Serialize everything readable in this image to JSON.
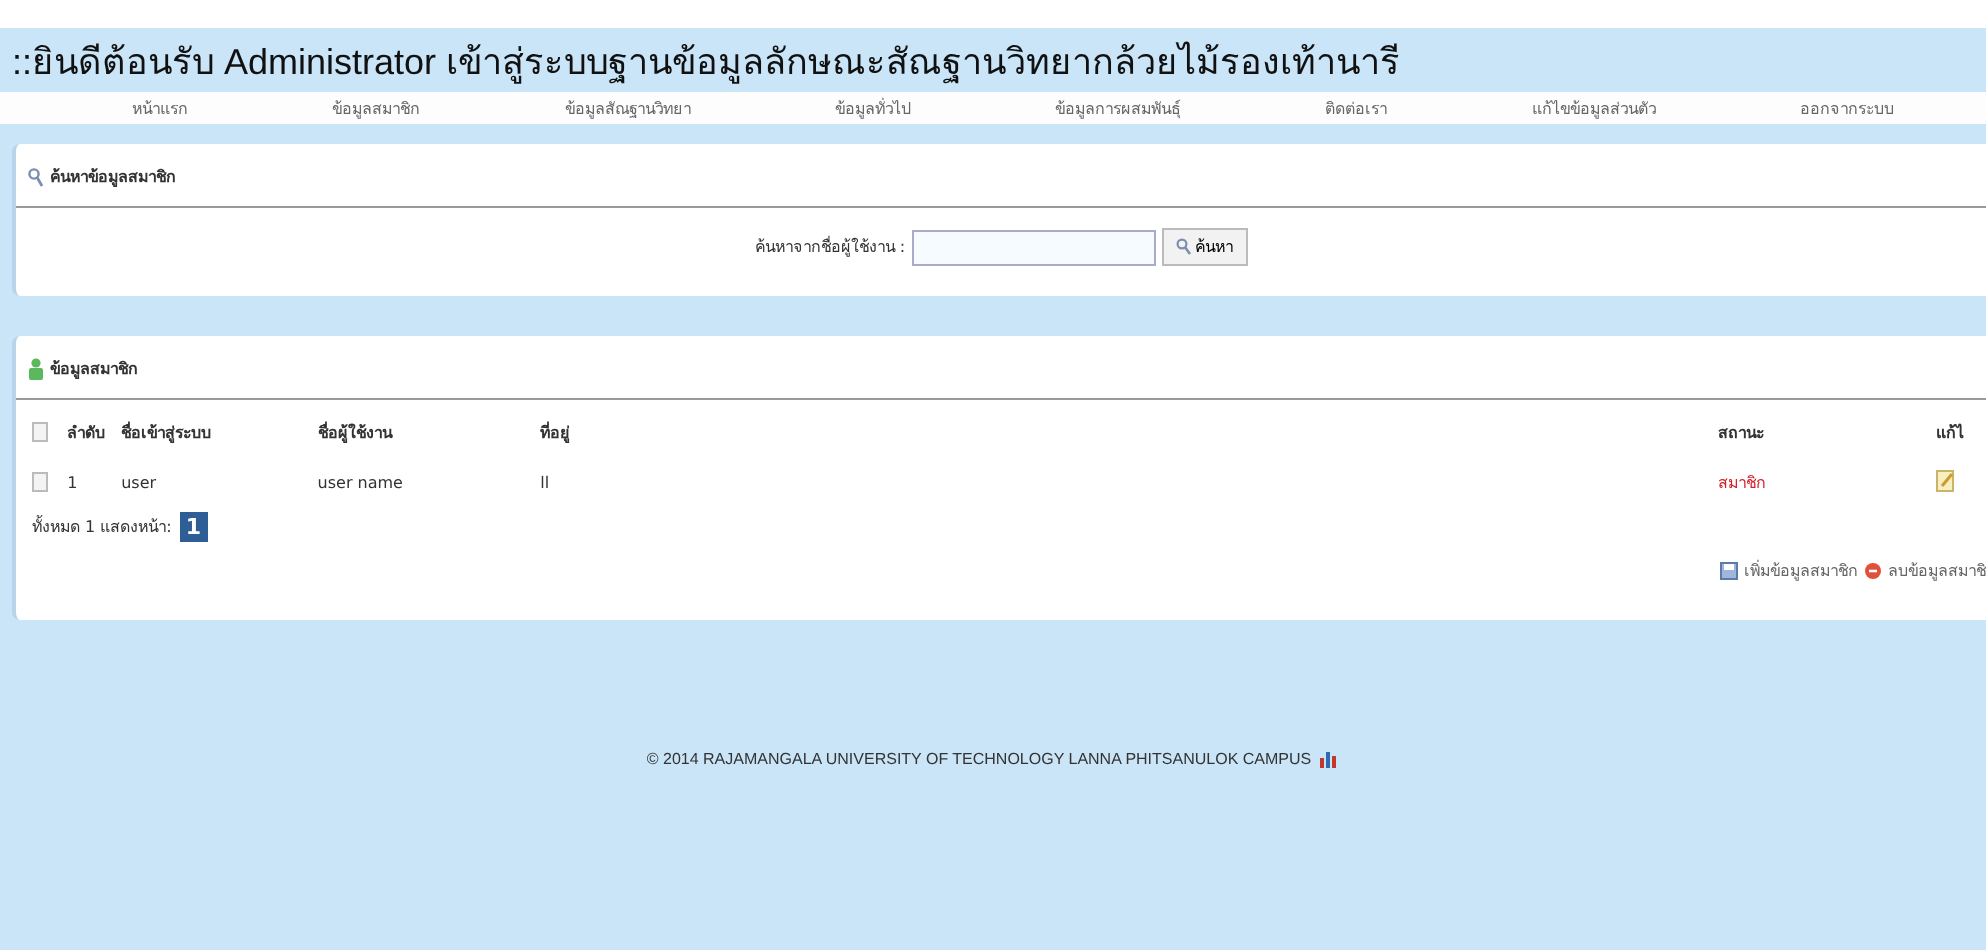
{
  "title": "::ยินดีต้อนรับ Administrator เข้าสู่ระบบฐานข้อมูลลักษณะสัณฐานวิทยากล้วยไม้รองเท้านารี",
  "nav": [
    {
      "label": "หน้าแรก"
    },
    {
      "label": "ข้อมูลสมาชิก"
    },
    {
      "label": "ข้อมูลสัณฐานวิทยา"
    },
    {
      "label": "ข้อมูลทั่วไป"
    },
    {
      "label": "ข้อมูลการผสมพันธุ์"
    },
    {
      "label": "ติดต่อเรา"
    },
    {
      "label": "แก้ไขข้อมูลส่วนตัว"
    },
    {
      "label": "ออกจากระบบ"
    }
  ],
  "search_panel": {
    "title": "ค้นหาข้อมูลสมาชิก",
    "label": "ค้นหาจากชื่อผู้ใช้งาน :",
    "button": "ค้นหา"
  },
  "members_panel": {
    "title": "ข้อมูลสมาชิก",
    "select_all_checked": false,
    "columns": [
      "ลำดับ",
      "ชื่อเข้าสู่ระบบ",
      "ชื่อผู้ใช้งาน",
      "ที่อยู่",
      "สถานะ",
      "แก้ไ"
    ],
    "rows": [
      {
        "checked": false,
        "no": "1",
        "login": "user",
        "name": "user name",
        "address": "ll",
        "status": "สมาชิก"
      }
    ],
    "total_label": "ทั้งหมด 1 แสดงหน้า:",
    "pages": [
      {
        "label": "1",
        "selected": true
      }
    ],
    "actions": [
      {
        "kind": "add",
        "label": "เพิ่มข้อมูลสมาชิก"
      },
      {
        "kind": "delete",
        "label": "ลบข้อมูลสมาชิ"
      }
    ]
  },
  "footer": "© 2014 RAJAMANGALA UNIVERSITY OF TECHNOLOGY LANNA PHITSANULOK CAMPUS"
}
